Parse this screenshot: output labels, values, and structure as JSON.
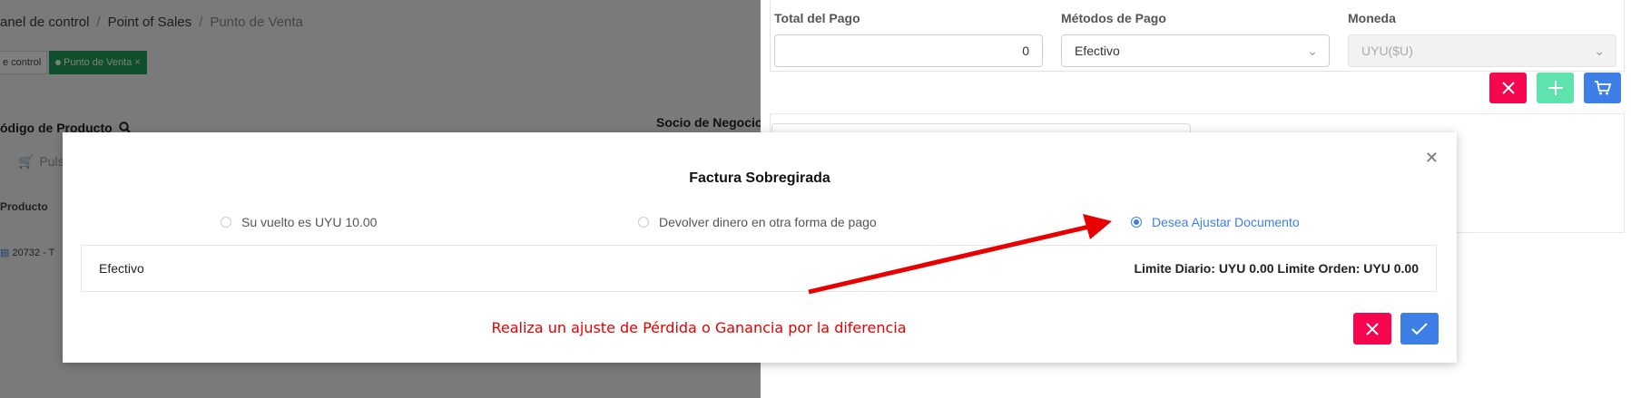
{
  "breadcrumb": {
    "item1": "anel de control",
    "item2": "Point of Sales",
    "item3": "Punto de Venta"
  },
  "tabs": {
    "tab1": "e control",
    "tab2": "Punto de Venta",
    "tab2_close": "×"
  },
  "left": {
    "codigo_label": "ódigo de Producto",
    "socio_label": "Socio de Negocio",
    "search_placeholder": "Pulse er",
    "col_producto": "Producto",
    "row_item": "20732 - T"
  },
  "payment": {
    "total_label": "Total del Pago",
    "total_value": "0",
    "metodos_label": "Métodos de Pago",
    "metodo_value": "Efectivo",
    "moneda_label": "Moneda",
    "moneda_value": "UYU($U)"
  },
  "modal": {
    "title": "Factura Sobregirada",
    "options": [
      "Su vuelto es UYU 10.00",
      "Devolver dinero en otra forma de pago",
      "Desea Ajustar Documento"
    ],
    "selected_option": 2,
    "row_method": "Efectivo",
    "row_limits": "Limite Diario: UYU 0.00 Limite Orden: UYU 0.00",
    "note": "Realiza un ajuste de Pérdida o Ganancia por la diferencia"
  },
  "icons": {
    "close": "close-icon",
    "cancel": "x-icon",
    "confirm": "check-icon",
    "add": "plus-icon",
    "cart": "cart-icon",
    "search": "search-icon",
    "chevron": "chevron-down-icon"
  },
  "colors": {
    "accent": "#3d7fe6",
    "danger": "#f5064f",
    "success": "#5ee3ad",
    "tab_active": "#1e9e58",
    "annotation": "#e80000"
  }
}
